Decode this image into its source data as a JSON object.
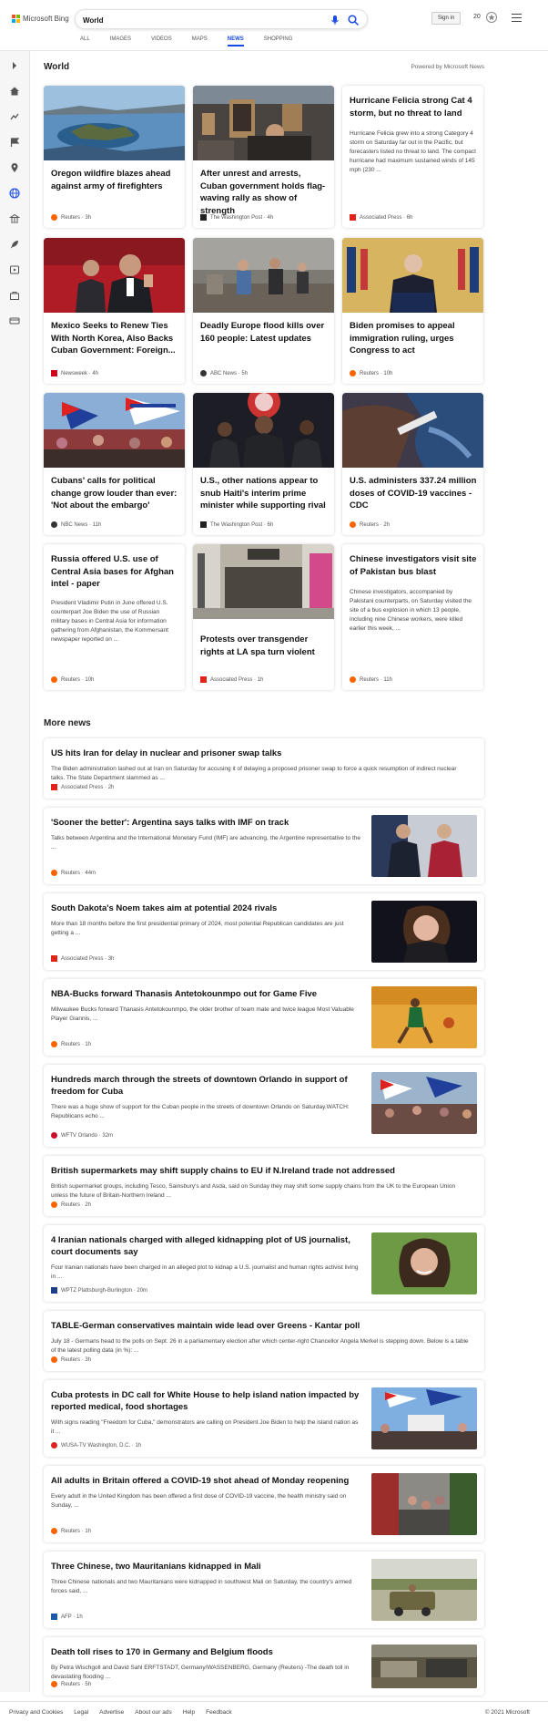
{
  "header": {
    "logo_text": "Microsoft Bing",
    "search_value": "World",
    "signin_label": "Sign in",
    "points": "20",
    "tabs": [
      "ALL",
      "IMAGES",
      "VIDEOS",
      "MAPS",
      "NEWS",
      "SHOPPING"
    ],
    "active_tab": "NEWS"
  },
  "world": {
    "title": "World",
    "powered_by": "Powered by Microsoft News",
    "cards": [
      {
        "title": "Oregon wildfire blazes ahead against army of firefighters",
        "source": "Reuters",
        "age": "3h"
      },
      {
        "title": "After unrest and arrests, Cuban government holds flag-waving rally as show of strength",
        "source": "The Washington Post",
        "age": "4h"
      },
      {
        "title": "Hurricane Felicia strong Cat 4 storm, but no threat to land",
        "snippet": "Hurricane Felicia grew into a strong Category 4 storm on Saturday far out in the Pacific, but forecasters listed no threat to land. The compact hurricane had maximum sustained winds of 145 mph (230 ...",
        "source": "Associated Press",
        "age": "6h"
      },
      {
        "title": "Mexico Seeks to Renew Ties With North Korea, Also Backs Cuban Government: Foreign...",
        "source": "Newsweek",
        "age": "4h"
      },
      {
        "title": "Deadly Europe flood kills over 160 people: Latest updates",
        "source": "ABC News",
        "age": "5h"
      },
      {
        "title": "Biden promises to appeal immigration ruling, urges Congress to act",
        "source": "Reuters",
        "age": "10h"
      },
      {
        "title": "Cubans' calls for political change grow louder than ever: 'Not about the embargo'",
        "source": "NBC News",
        "age": "11h"
      },
      {
        "title": "U.S., other nations appear to snub Haiti's interim prime minister while supporting rival",
        "source": "The Washington Post",
        "age": "6h"
      },
      {
        "title": "U.S. administers 337.24 million doses of COVID-19 vaccines - CDC",
        "source": "Reuters",
        "age": "2h"
      },
      {
        "title": "Russia offered U.S. use of Central Asia bases for Afghan intel - paper",
        "snippet": "President Vladimir Putin in June offered U.S. counterpart Joe Biden the use of Russian military bases in Central Asia for information gathering from Afghanistan, the Kommersant newspaper reported on ...",
        "source": "Reuters",
        "age": "10h"
      },
      {
        "title": "Protests over transgender rights at LA spa turn violent",
        "source": "Associated Press",
        "age": "1h"
      },
      {
        "title": "Chinese investigators visit site of Pakistan bus blast",
        "snippet": "Chinese investigators, accompanied by Pakistani counterparts, on Saturday visited the site of a bus explosion in which 13 people, including nine Chinese workers, were killed earlier this week, ...",
        "source": "Reuters",
        "age": "11h"
      }
    ]
  },
  "more_news": {
    "title": "More news",
    "items": [
      {
        "title": "US hits Iran for delay in nuclear and prisoner swap talks",
        "snippet": "The Biden administration lashed out at Iran on Saturday for accusing it of delaying a proposed prisoner swap to force a quick resumption of indirect nuclear talks. The State Department slammed as ...",
        "source": "Associated Press",
        "age": "2h"
      },
      {
        "title": "'Sooner the better': Argentina says talks with IMF on track",
        "snippet": "Talks between Argentina and the International Monetary Fund (IMF) are advancing, the Argentine representative to the ...",
        "source": "Reuters",
        "age": "44m"
      },
      {
        "title": "South Dakota's Noem takes aim at potential 2024 rivals",
        "snippet": "More than 18 months before the first presidential primary of 2024, most potential Republican candidates are just getting a ...",
        "source": "Associated Press",
        "age": "3h"
      },
      {
        "title": "NBA-Bucks forward Thanasis Antetokounmpo out for Game Five",
        "snippet": "Milwaukee Bucks forward Thanasis Antetokounmpo, the older brother of team mate and twice league Most Valuable Player Giannis, ...",
        "source": "Reuters",
        "age": "1h"
      },
      {
        "title": "Hundreds march through the streets of downtown Orlando in support of freedom for Cuba",
        "snippet": "There was a huge show of support for the Cuban people in the streets of downtown Orlando on Saturday.WATCH: Republicans echo ...",
        "source": "WFTV Orlando",
        "age": "32m"
      },
      {
        "title": "British supermarkets may shift supply chains to EU if N.Ireland trade not addressed",
        "snippet": "British supermarket groups, including Tesco, Sainsbury's and Asda, said on Sunday they may shift some supply chains from the UK to the European Union unless the future of Britain-Northern Ireland ...",
        "source": "Reuters",
        "age": "2h"
      },
      {
        "title": "4 Iranian nationals charged with alleged kidnapping plot of US journalist, court documents say",
        "snippet": "Four Iranian nationals have been charged in an alleged plot to kidnap a U.S. journalist and human rights activist living in ...",
        "source": "WPTZ Plattsburgh-Burlington",
        "age": "20m"
      },
      {
        "title": "TABLE-German conservatives maintain wide lead over Greens - Kantar poll",
        "snippet": "July 18 - Germans head to the polls on Sept. 26 in a parliamentary election after which center-right Chancellor Angela Merkel is stepping down. Below is a table of the latest polling data (in %): ...",
        "source": "Reuters",
        "age": "3h"
      },
      {
        "title": "Cuba protests in DC call for White House to help island nation impacted by reported medical, food shortages",
        "snippet": "With signs reading \"Freedom for Cuba,\" demonstrators are calling on President Joe Biden to help the island nation as it ...",
        "source": "WUSA-TV Washington, D.C.",
        "age": "1h"
      },
      {
        "title": "All adults in Britain offered a COVID-19 shot ahead of Monday reopening",
        "snippet": "Every adult in the United Kingdom has been offered a first dose of COVID-19 vaccine, the health ministry said on Sunday, ...",
        "source": "Reuters",
        "age": "1h"
      },
      {
        "title": "Three Chinese, two Mauritanians kidnapped in Mali",
        "snippet": "Three Chinese nationals and two Mauritanians were kidnapped in southwest Mali on Saturday, the country's armed forces said, ...",
        "source": "AFP",
        "age": "1h"
      },
      {
        "title": "Death toll rises to 170 in Germany and Belgium floods",
        "snippet": "By Petra Wischgoll and David Sahl ERFTSTADT, Germany/WASSENBERG, Germany (Reuters) -The death toll in devastating flooding ...",
        "source": "Reuters",
        "age": "5h"
      }
    ]
  },
  "footer": {
    "links": [
      "Privacy and Cookies",
      "Legal",
      "Advertise",
      "About our ads",
      "Help",
      "Feedback"
    ],
    "copyright": "© 2021 Microsoft"
  },
  "colors": {
    "accent": "#174ae4",
    "reuters": "#fa6400",
    "ap": "#e2231a"
  }
}
